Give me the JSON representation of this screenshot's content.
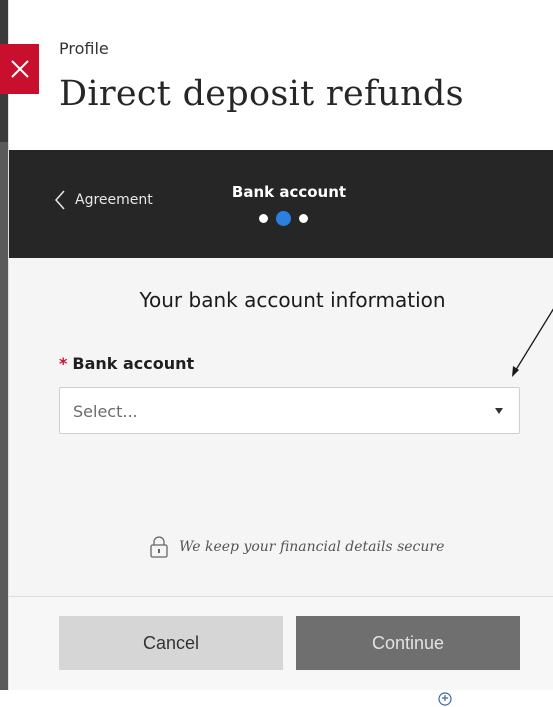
{
  "header": {
    "eyebrow": "Profile",
    "title": "Direct deposit refunds"
  },
  "stepper": {
    "back_label": "Agreement",
    "current_step": "Bank account",
    "total_steps": 3,
    "active_step": 2
  },
  "form": {
    "section_title": "Your bank account information",
    "required_marker": "*",
    "bank_account_label": "Bank account",
    "bank_account_value": "Select...",
    "secure_note": "We keep your financial details secure"
  },
  "footer": {
    "cancel_label": "Cancel",
    "continue_label": "Continue"
  },
  "colors": {
    "brand_red": "#c8102e",
    "stepper_bg": "#262626",
    "active_dot": "#2b7fe0",
    "continue_bg": "#6f6f6f",
    "cancel_bg": "#d6d6d6"
  },
  "icons": {
    "close": "close-icon",
    "back": "chevron-left-icon",
    "caret": "caret-down-icon",
    "lock": "lock-icon"
  }
}
